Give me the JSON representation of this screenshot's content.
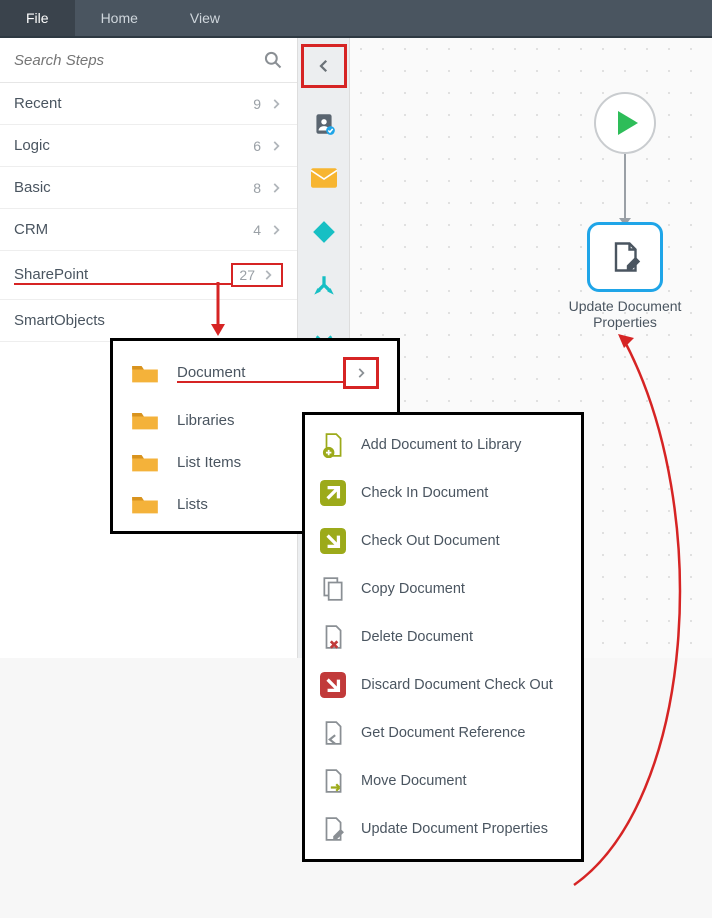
{
  "menubar": {
    "items": [
      "File",
      "Home",
      "View"
    ],
    "active_index": 0
  },
  "search": {
    "placeholder": "Search Steps"
  },
  "categories": [
    {
      "label": "Recent",
      "count": 9
    },
    {
      "label": "Logic",
      "count": 6
    },
    {
      "label": "Basic",
      "count": 8
    },
    {
      "label": "CRM",
      "count": 4
    },
    {
      "label": "SharePoint",
      "count": 27,
      "highlighted": true
    },
    {
      "label": "SmartObjects",
      "count": null
    }
  ],
  "flyout1": {
    "items": [
      {
        "label": "Document",
        "has_children": true,
        "highlighted": true
      },
      {
        "label": "Libraries",
        "has_children": false
      },
      {
        "label": "List Items",
        "has_children": false
      },
      {
        "label": "Lists",
        "has_children": false
      }
    ]
  },
  "flyout2": {
    "items": [
      {
        "label": "Add Document to Library",
        "icon": "doc-add"
      },
      {
        "label": "Check In Document",
        "icon": "check-in"
      },
      {
        "label": "Check Out Document",
        "icon": "check-out"
      },
      {
        "label": "Copy Document",
        "icon": "copy"
      },
      {
        "label": "Delete Document",
        "icon": "delete"
      },
      {
        "label": "Discard Document Check Out",
        "icon": "discard"
      },
      {
        "label": "Get Document Reference",
        "icon": "get-ref"
      },
      {
        "label": "Move Document",
        "icon": "move"
      },
      {
        "label": "Update Document Properties",
        "icon": "update"
      }
    ]
  },
  "canvas": {
    "step_label": "Update Document Properties"
  },
  "colors": {
    "annotation_red": "#d62424",
    "olive": "#9caa1a",
    "crimson": "#c13a3a",
    "teal": "#17bfc4",
    "blue": "#1fa5e8"
  }
}
